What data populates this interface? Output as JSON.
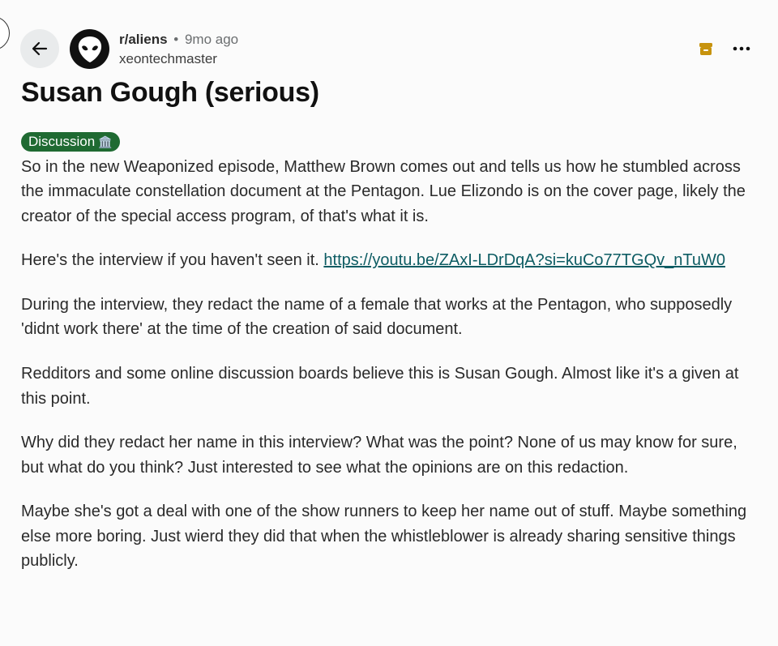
{
  "post": {
    "subreddit": "r/aliens",
    "separator": "•",
    "age": "9mo ago",
    "author": "xeontechmaster",
    "title": "Susan Gough (serious)",
    "flair": {
      "label": "Discussion",
      "emoji": "🏛️",
      "color": "#1f6a32"
    },
    "paragraphs": {
      "p1": "So in the new Weaponized episode, Matthew Brown comes out and tells us how he stumbled across the immaculate constellation document at the Pentagon. Lue Elizondo is on the cover page, likely the creator of the special access program, of that's what it is.",
      "p2_text": "Here's the interview if you haven't seen it. ",
      "p2_link": "https://youtu.be/ZAxI-LDrDqA?si=kuCo77TGQv_nTuW0",
      "p3": "During the interview, they redact the name of a female that works at the Pentagon, who supposedly 'didnt work there' at the time of the creation of said document.",
      "p4": "Redditors and some online discussion boards believe this is Susan Gough. Almost like it's a given at this point.",
      "p5": "Why did they redact her name in this interview? What was the point? None of us may know for sure, but what do you think? Just interested to see what the opinions are on this redaction.",
      "p6": "Maybe she's got a deal with one of the show runners to keep her name out of stuff. Maybe something else more boring. Just wierd they did that when the whistleblower is already sharing sensitive things publicly."
    }
  },
  "icons": {
    "back": "arrow-left-icon",
    "avatar": "alien-head-icon",
    "archive": "archive-box-icon",
    "more": "more-horizontal-icon"
  },
  "colors": {
    "archive_icon": "#c7930e",
    "link": "#0d5c63"
  }
}
